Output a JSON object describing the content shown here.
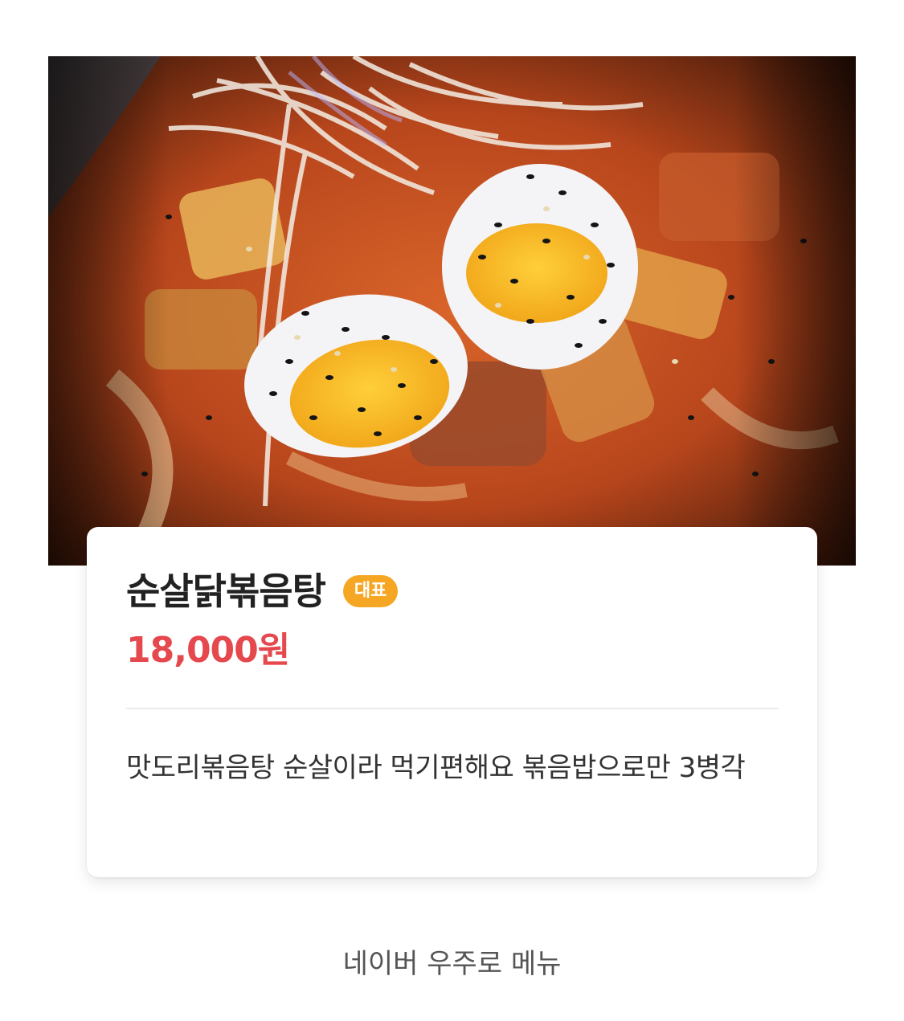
{
  "menu_item": {
    "photo_alt": "순살닭볶음탕",
    "title": "순살닭볶음탕",
    "badge": "대표",
    "price": "18,000원",
    "description": "맛도리볶음탕 순살이라 먹기편해요 볶음밥으로만 3병각"
  },
  "footer": {
    "text": "네이버 우주로 메뉴"
  },
  "colors": {
    "badge_bg": "#f5a623",
    "price": "#e5484d",
    "title": "#222222"
  }
}
